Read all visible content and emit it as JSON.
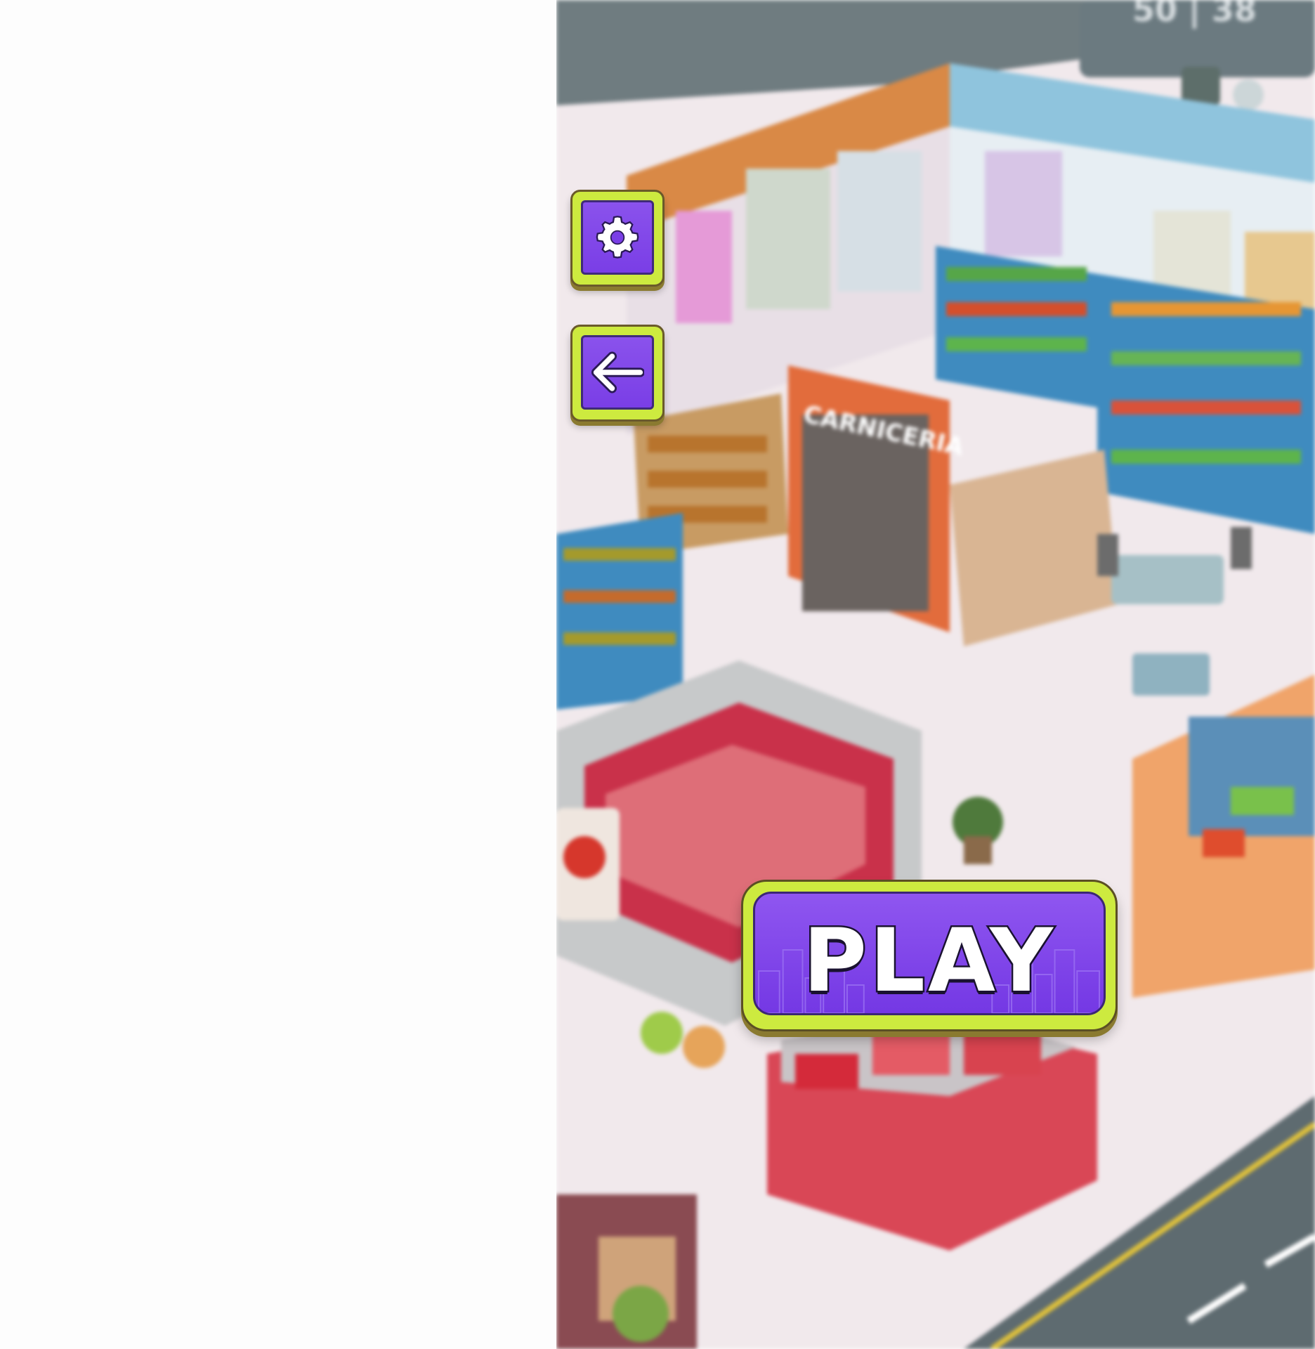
{
  "game": {
    "play_button": {
      "label": "PLAY",
      "icon": "city-skyline-pattern"
    },
    "settings_button": {
      "icon": "gear-icon"
    },
    "back_button": {
      "icon": "arrow-left-icon"
    },
    "background": {
      "scene": "isometric supermarket",
      "store_signs": [
        "CARNICERIA"
      ],
      "hud_partial_text": "50 | 38"
    }
  },
  "colors": {
    "button_purple": "#7a3ee6",
    "button_lime_border": "#cdea3f",
    "text_white": "#ffffff",
    "outline_dark": "#1a1230"
  }
}
